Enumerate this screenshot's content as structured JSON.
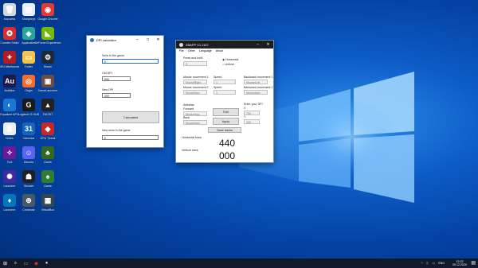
{
  "desktop_icons": [
    {
      "name": "recycle-bin-icon",
      "label": "Корзина",
      "color": "#cfd8dc",
      "glyph": "🗑"
    },
    {
      "name": "shortcut-icon",
      "label": "Sharpkeys",
      "color": "#e9eef2",
      "glyph": "▤"
    },
    {
      "name": "chrome-icon",
      "label": "Google Chrome",
      "color": "#e53935",
      "glyph": "◉"
    },
    {
      "name": "game-icon",
      "label": "Counter-Strike",
      "color": "#d32f2f",
      "glyph": "✪"
    },
    {
      "name": "app-icon",
      "label": "Application",
      "color": "#26a69a",
      "glyph": "◈"
    },
    {
      "name": "nvidia-icon",
      "label": "GeForce Experience",
      "color": "#76b900",
      "glyph": "◣"
    },
    {
      "name": "msi-icon",
      "label": "MSI Afterburner",
      "color": "#b71c1c",
      "glyph": "✦"
    },
    {
      "name": "folder-icon",
      "label": "Folder",
      "color": "#f4c542",
      "glyph": "▭"
    },
    {
      "name": "steam-icon",
      "label": "Steam",
      "color": "#1b2838",
      "glyph": "⚙"
    },
    {
      "name": "audition-icon",
      "label": "Audition",
      "color": "#1a1a4a",
      "glyph": "Au"
    },
    {
      "name": "origin-icon",
      "label": "Origin",
      "color": "#f56c2d",
      "glyph": "◎"
    },
    {
      "name": "game2-icon",
      "label": "GameLauncher",
      "color": "#6d4c41",
      "glyph": "▣"
    },
    {
      "name": "audio-icon",
      "label": "Equalizer APO",
      "color": "#1976d2",
      "glyph": "◐"
    },
    {
      "name": "logitech-icon",
      "label": "Logitech G HUB",
      "color": "#1a1a1a",
      "glyph": "G"
    },
    {
      "name": "faceit-icon",
      "label": "FACEIT",
      "color": "#222",
      "glyph": "▲"
    },
    {
      "name": "doc-icon",
      "label": "Notes",
      "color": "#eceff1",
      "glyph": "≣"
    },
    {
      "name": "calendar-icon",
      "label": "Calendar",
      "color": "#1565c0",
      "glyph": "31"
    },
    {
      "name": "gpu-icon",
      "label": "GPU Tweak",
      "color": "#c62828",
      "glyph": "◆"
    },
    {
      "name": "tool-icon",
      "label": "Tool",
      "color": "#6a1b9a",
      "glyph": "✧"
    },
    {
      "name": "discord-icon",
      "label": "Discord",
      "color": "#5865f2",
      "glyph": "☺"
    },
    {
      "name": "game3-icon",
      "label": "Game",
      "color": "#33691e",
      "glyph": "♣"
    },
    {
      "name": "game4-icon",
      "label": "Launcher",
      "color": "#4527a0",
      "glyph": "✺"
    },
    {
      "name": "game5-icon",
      "label": "Shooter",
      "color": "#212121",
      "glyph": "☗"
    },
    {
      "name": "game6-icon",
      "label": "Game",
      "color": "#2e7d32",
      "glyph": "♠"
    },
    {
      "name": "game7-icon",
      "label": "Launcher",
      "color": "#0277bd",
      "glyph": "♦"
    },
    {
      "name": "crosshair-icon",
      "label": "Crosshair",
      "color": "#455a64",
      "glyph": "⊕"
    },
    {
      "name": "vm-icon",
      "label": "VirtualBox",
      "color": "#37474f",
      "glyph": "▦"
    }
  ],
  "dpi_window": {
    "title": "DPI calculator",
    "sens_label": "Sens in the game",
    "sens_value": "0",
    "old_dpi_label": "Old DPI",
    "old_dpi_value": "800",
    "new_dpi_label": "New DPI",
    "new_dpi_value": "400",
    "calc_button": "Calculated",
    "new_sens_label": "New sens in the game",
    "new_sens_value": "0"
  },
  "sens_window": {
    "title": "ZBAPP V1.1107",
    "menu": [
      "File",
      "Other",
      "Language",
      "About"
    ],
    "press_hold_label": "Press and hold:",
    "press_hold_value": "S",
    "radio_horizontal": "Horizontal",
    "radio_vertical": "vertical",
    "mouse_move1_label": "Mouse movement 1",
    "mouse_move1_value": "MouseRight",
    "speed1_label": "Speed",
    "speed1_value": "1",
    "backward1_label": "Backward movement 1",
    "backward1_value": "MouseLeft",
    "mouse_move2_label": "Mouse movement 2",
    "mouse_move2_value": "Mouseface",
    "speed2_label": "Speed",
    "speed2_value": "1",
    "backward2_label": "Backward movement 2",
    "backward2_value": "Mouseface",
    "antialias_label": "Antialias",
    "forward_label": "Forward",
    "forward_value": "Mouseface",
    "back_label": "Back",
    "back_value": "Mouseface",
    "edit_button": "Edit",
    "apply_button": "Apply",
    "dpi_label": "Enter your DPI",
    "x_label": "X",
    "x_value": "750",
    "y_label": "Y",
    "y_value": "300",
    "save_button": "Save tracks",
    "horizontal_track_label": "Horizontal track",
    "horizontal_track_value": "440",
    "vertical_track_label": "Vertical track",
    "vertical_track_value": "000"
  },
  "taskbar": {
    "search_placeholder": "",
    "lang": "ENG",
    "time": "12:22",
    "date": "09.12.2020"
  }
}
